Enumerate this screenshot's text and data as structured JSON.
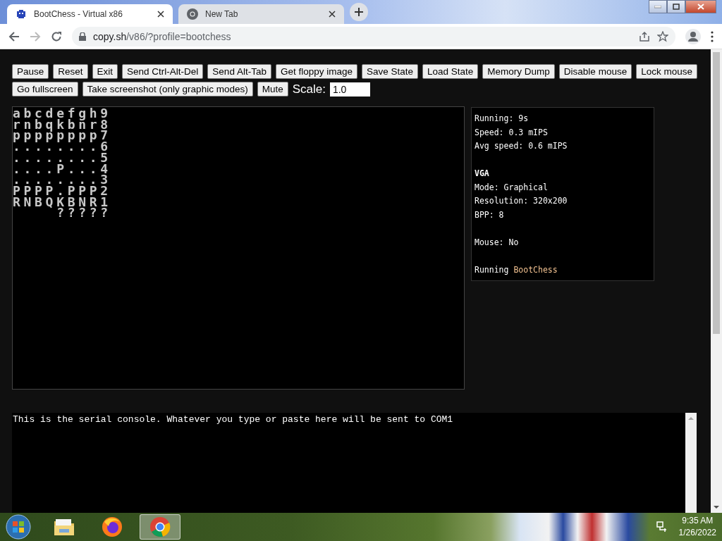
{
  "tabs": [
    {
      "title": "BootChess - Virtual x86",
      "selected": true
    },
    {
      "title": "New Tab",
      "selected": false
    }
  ],
  "address": {
    "host": "copy.sh",
    "path": "/v86/?profile=bootchess"
  },
  "toolbar": {
    "buttons": [
      "Pause",
      "Reset",
      "Exit",
      "Send Ctrl-Alt-Del",
      "Send Alt-Tab",
      "Get floppy image",
      "Save State",
      "Load State",
      "Memory Dump",
      "Disable mouse",
      "Lock mouse",
      "Go fullscreen",
      "Take screenshot (only graphic modes)",
      "Mute"
    ],
    "scale_label": "Scale:",
    "scale_value": "1.0"
  },
  "screen_lines": [
    "abcdefgh9",
    "rnbqkbnr8",
    "pppppppp7",
    "........6",
    "........5",
    "....P...4",
    "........3",
    "PPPP.PPP2",
    "RNBQKBNR1",
    "    ?????"
  ],
  "info": [
    [
      {
        "kind": "line",
        "text": "Running: 9s"
      },
      {
        "kind": "line",
        "text": "Speed: 0.3 mIPS"
      },
      {
        "kind": "line",
        "text": "Avg speed: 0.6 mIPS"
      }
    ],
    [
      {
        "kind": "heading",
        "text": "VGA"
      },
      {
        "kind": "line",
        "text": "Mode: Graphical"
      },
      {
        "kind": "line",
        "text": "Resolution: 320x200"
      },
      {
        "kind": "line",
        "text": "BPP: 8"
      }
    ],
    [
      {
        "kind": "line",
        "text": "Mouse: No"
      }
    ],
    [
      {
        "kind": "program",
        "text": "Running",
        "program": "BootChess"
      }
    ]
  ],
  "serial_console": "This is the serial console. Whatever you type or paste here will be sent to COM1",
  "taskbar": {
    "apps": [
      {
        "kind": "explorer",
        "selected": false
      },
      {
        "kind": "firefox",
        "selected": false
      },
      {
        "kind": "chrome",
        "selected": true
      }
    ],
    "time": "9:35 AM",
    "date": "1/26/2022"
  }
}
